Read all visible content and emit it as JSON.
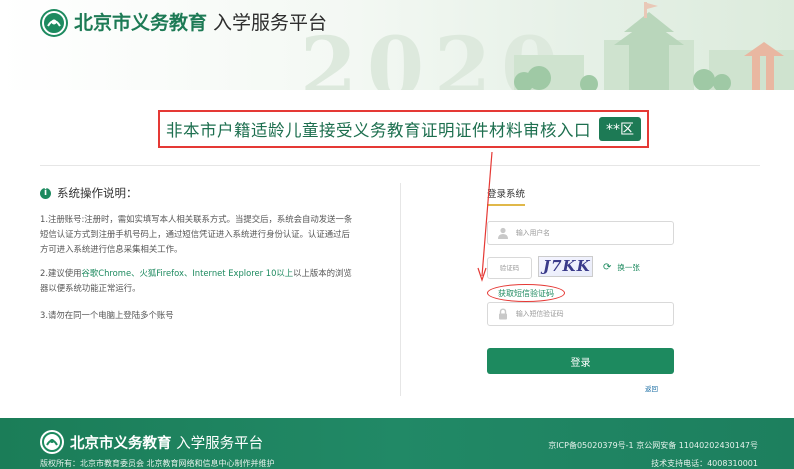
{
  "header": {
    "brand_strong": "北京市义务教育",
    "brand_light": "入学服务平台",
    "background_year": "2020"
  },
  "banner": {
    "title": "非本市户籍适龄儿童接受义务教育证明证件材料审核入口",
    "district": "**区"
  },
  "instructions": {
    "title": "系统操作说明：",
    "item1": "1.注册账号:注册时，需如实填写本人相关联系方式。当提交后，系统会自动发送一条短信认证方式到注册手机号码上，通过短信凭证进入系统进行身份认证。认证通过后方可进入系统进行信息采集相关工作。",
    "item2_prefix": "2.建议使用",
    "item2_browsers": "谷歌Chrome、火狐Firefox、Internet Explorer 10以上",
    "item2_suffix": "以上版本的浏览器以便系统功能正常运行。",
    "item3": "3.请勿在同一个电脑上登陆多个账号"
  },
  "login": {
    "title": "登录系统",
    "username_placeholder": "输入用户名",
    "captcha_placeholder": "验证码",
    "captcha_text": "J7KK",
    "refresh_label": "换一张",
    "sms_button": "获取短信验证码",
    "sms_placeholder": "输入短信验证码",
    "login_button": "登录",
    "back_link": "返回"
  },
  "footer": {
    "brand_strong": "北京市义务教育",
    "brand_light": "入学服务平台",
    "copyright": "版权所有：北京市教育委员会 北京教育网络和信息中心制作并维护",
    "icp": "京ICP备05020379号-1 京公网安备 11040202430147号",
    "support": "技术支持电话：4008310001"
  },
  "colors": {
    "brand_green": "#1d8a5f",
    "highlight_red": "#e53935",
    "accent_gold": "#e0b84a"
  }
}
